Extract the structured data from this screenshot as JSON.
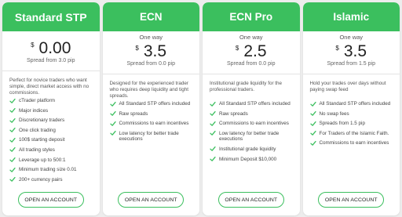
{
  "accent_color": "#3bbf5e",
  "cards": [
    {
      "title": "Standard STP",
      "one_way": "",
      "currency": "$",
      "price": "0.00",
      "spread": "Spread from 3.0 pip",
      "description": "Perfect for novice traders who want simple, direct market access with no commissions.",
      "features": [
        "cTrader platform",
        "Major indices",
        "Discretionary traders",
        "One click trading",
        "100$ starting deposit",
        "All trading styles",
        "Leverage up to 500:1",
        "Minimum trading size 0.01",
        "200+ currency pairs"
      ],
      "button": "OPEN AN ACCOUNT"
    },
    {
      "title": "ECN",
      "one_way": "One way",
      "currency": "$",
      "price": "3.5",
      "spread": "Spread from 0.0 pip",
      "description": "Designed for the experienced trader who requires deep liquidity and tight spreads.",
      "features": [
        "All Standard STP offers included",
        "Raw spreads",
        "Commissions to earn incentives",
        "Low latency for better trade executions"
      ],
      "button": "OPEN AN ACCOUNT"
    },
    {
      "title": "ECN Pro",
      "one_way": "One way",
      "currency": "$",
      "price": "2.5",
      "spread": "Spread from 0.0 pip",
      "description": "Institutional grade liquidity for the professional traders.",
      "features": [
        "All Standard STP offers included",
        "Raw spreads",
        "Commissions to earn incentives",
        "Low latency for better trade executions",
        "Institutional grade liquidity",
        "Minimum Deposit $10,000"
      ],
      "button": "OPEN AN ACCOUNT"
    },
    {
      "title": "Islamic",
      "one_way": "One way",
      "currency": "$",
      "price": "3.5",
      "spread": "Spread from 1.5 pip",
      "description": "Hold your trades over days without paying swap feed",
      "features": [
        "All Standard STP offers included",
        "No swap fees",
        "Spreads from 1.5 pip",
        "For Traders of the Islamic Faith.",
        "Commissions to earn incentives"
      ],
      "button": "OPEN AN ACCOUNT"
    }
  ]
}
